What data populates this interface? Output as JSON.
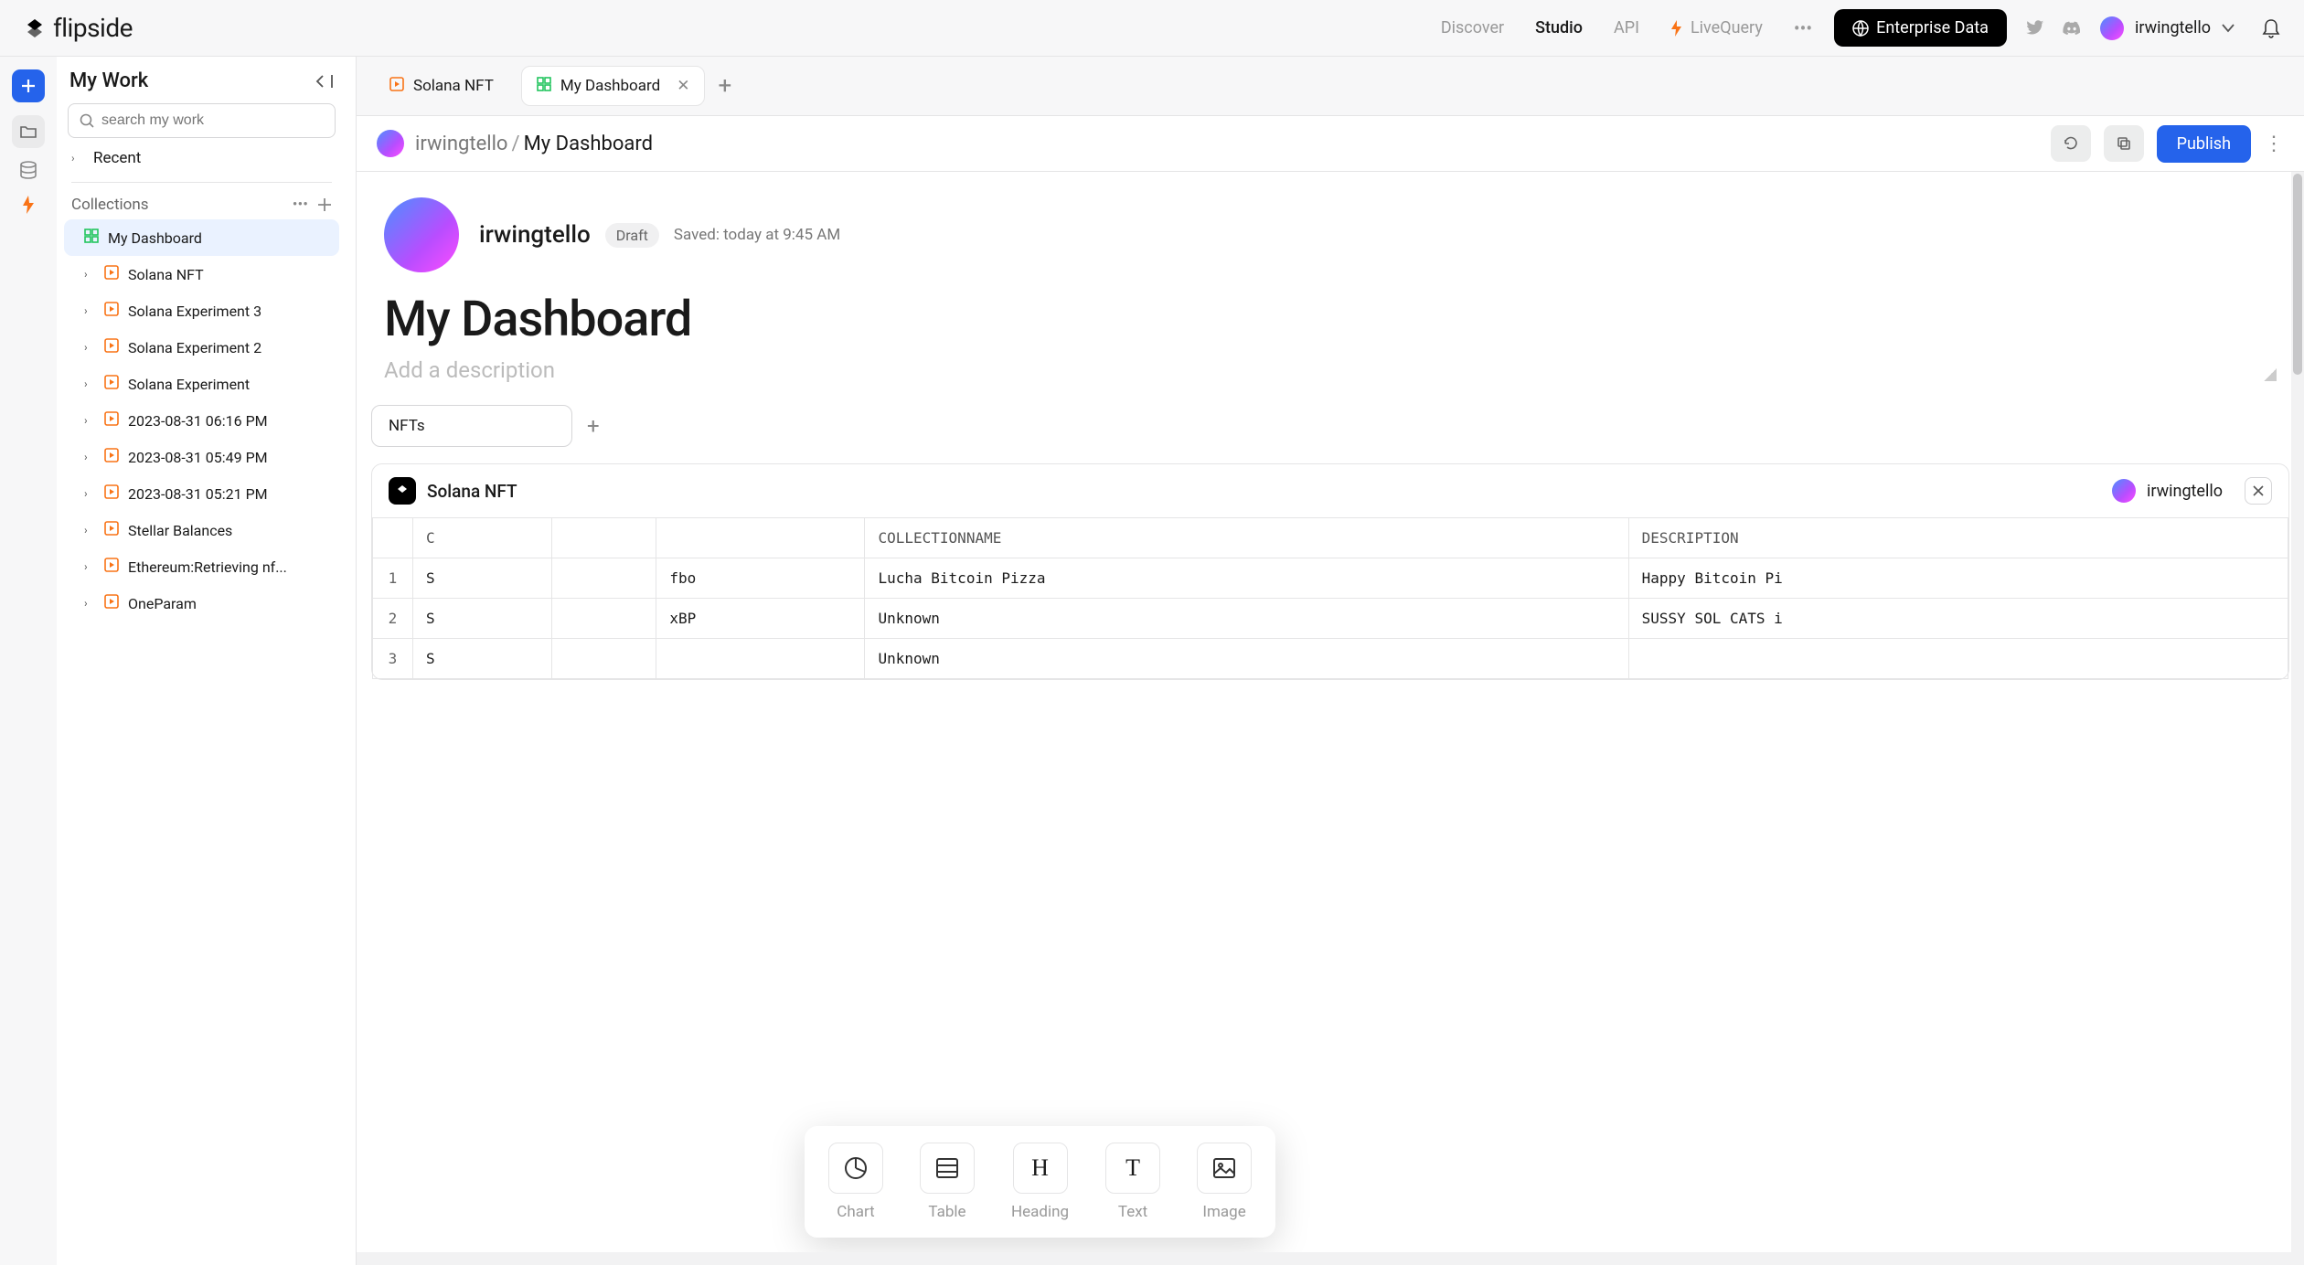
{
  "brand": "flipside",
  "nav": {
    "discover": "Discover",
    "studio": "Studio",
    "api": "API",
    "livequery": "LiveQuery",
    "enterprise": "Enterprise Data"
  },
  "user": {
    "name": "irwingtello"
  },
  "sidebar": {
    "title": "My Work",
    "search_placeholder": "search my work",
    "recent": "Recent",
    "collections_label": "Collections",
    "items": [
      {
        "label": "My Dashboard",
        "type": "dashboard",
        "active": true
      },
      {
        "label": "Solana NFT",
        "type": "query"
      },
      {
        "label": "Solana Experiment 3",
        "type": "query"
      },
      {
        "label": "Solana Experiment 2",
        "type": "query"
      },
      {
        "label": "Solana Experiment",
        "type": "query"
      },
      {
        "label": "2023-08-31 06:16 PM",
        "type": "query"
      },
      {
        "label": "2023-08-31 05:49 PM",
        "type": "query"
      },
      {
        "label": "2023-08-31 05:21 PM",
        "type": "query"
      },
      {
        "label": "Stellar Balances",
        "type": "query"
      },
      {
        "label": "Ethereum:Retrieving nf...",
        "type": "query"
      },
      {
        "label": "OneParam",
        "type": "query"
      }
    ]
  },
  "tabs": [
    {
      "label": "Solana NFT",
      "type": "query",
      "active": false
    },
    {
      "label": "My Dashboard",
      "type": "dashboard",
      "active": true
    }
  ],
  "crumb": {
    "owner": "irwingtello",
    "title": "My Dashboard",
    "publish": "Publish"
  },
  "dashboard": {
    "owner": "irwingtello",
    "status": "Draft",
    "saved": "Saved: today at 9:45 AM",
    "title": "My Dashboard",
    "desc_placeholder": "Add a description",
    "tab": "NFTs"
  },
  "widget": {
    "title": "Solana NFT",
    "user": "irwingtello",
    "columns": [
      "",
      "C",
      "",
      "",
      "COLLECTIONNAME",
      "DESCRIPTION"
    ],
    "rows": [
      [
        "1",
        "S",
        "",
        "fbo",
        "Lucha Bitcoin Pizza",
        "Happy Bitcoin Pi"
      ],
      [
        "2",
        "S",
        "",
        "xBP",
        "Unknown",
        "SUSSY SOL CATS i"
      ],
      [
        "3",
        "S",
        "",
        "",
        "Unknown",
        ""
      ]
    ]
  },
  "insert": {
    "chart": "Chart",
    "table": "Table",
    "heading": "Heading",
    "text": "Text",
    "image": "Image"
  }
}
